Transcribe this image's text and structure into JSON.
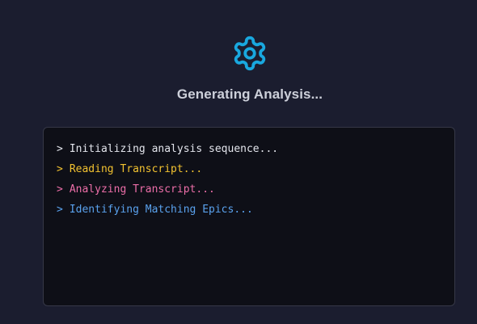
{
  "status": {
    "title": "Generating Analysis...",
    "icon": "gear-icon",
    "accent_color": "#19a8df"
  },
  "log": {
    "prompt": ">",
    "lines": [
      {
        "text": "Initializing analysis sequence...",
        "color": "#e3e5ec"
      },
      {
        "text": "Reading Transcript...",
        "color": "#f2c230"
      },
      {
        "text": "Analyzing Transcript...",
        "color": "#ec6ea8"
      },
      {
        "text": "Identifying Matching Epics...",
        "color": "#5aa2ee"
      }
    ]
  }
}
